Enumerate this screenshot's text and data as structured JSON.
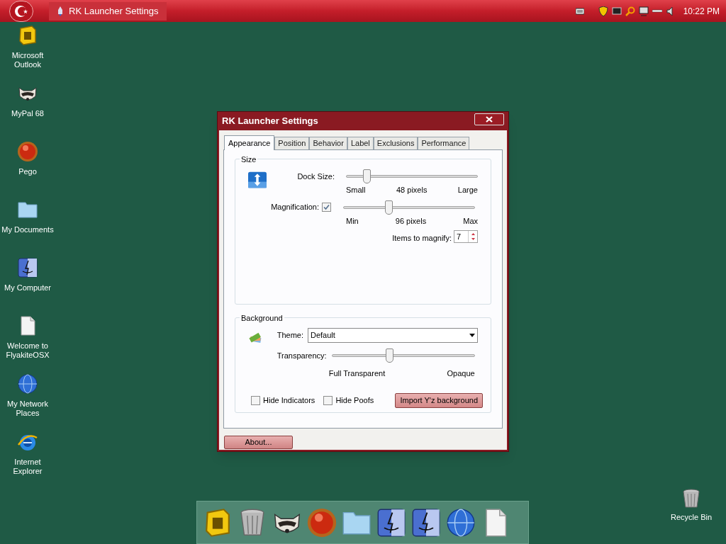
{
  "taskbar": {
    "task": "RK Launcher Settings",
    "clock": "10:22 PM"
  },
  "desktop_icons": [
    {
      "label": "Microsoft Outlook",
      "kind": "tile"
    },
    {
      "label": "MyPal 68",
      "kind": "raccoon"
    },
    {
      "label": "Pego",
      "kind": "ball"
    },
    {
      "label": "My Documents",
      "kind": "folder"
    },
    {
      "label": "My Computer",
      "kind": "finder"
    },
    {
      "label": "Welcome to FlyakiteOSX",
      "kind": "document"
    },
    {
      "label": "My Network Places",
      "kind": "globe"
    },
    {
      "label": "Internet Explorer",
      "kind": "ie"
    }
  ],
  "recycle_bin": {
    "label": "Recycle Bin"
  },
  "dialog": {
    "title": "RK Launcher Settings",
    "tabs": [
      {
        "label": "Appearance",
        "selected": true
      },
      {
        "label": "Position",
        "selected": false
      },
      {
        "label": "Behavior",
        "selected": false
      },
      {
        "label": "Label",
        "selected": false
      },
      {
        "label": "Exclusions",
        "selected": false
      },
      {
        "label": "Performance",
        "selected": false
      }
    ],
    "size_group": {
      "title": "Size",
      "dock_size": {
        "label": "Dock Size:",
        "level": 0.15,
        "min": "Small",
        "reading": "48 pixels",
        "max": "Large"
      },
      "magnification": {
        "label": "Magnification:",
        "checked": true,
        "level": 0.34,
        "min": "Min",
        "reading": "96 pixels",
        "max": "Max"
      },
      "items_to_magnify": {
        "label": "Items to magnify:",
        "value": "7"
      }
    },
    "background_group": {
      "title": "Background",
      "theme": {
        "label": "Theme:",
        "value": "Default"
      },
      "transparency": {
        "label": "Transparency:",
        "level": 0.4,
        "min": "Full Transparent",
        "max": "Opaque"
      },
      "checkboxes": [
        {
          "label": "Hide Indicators",
          "checked": false
        },
        {
          "label": "Hide Poofs",
          "checked": false
        }
      ],
      "import_button": "Import Y'z background"
    },
    "about_button": "About..."
  },
  "dock": [
    {
      "kind": "tile"
    },
    {
      "kind": "bin"
    },
    {
      "kind": "raccoon"
    },
    {
      "kind": "ball"
    },
    {
      "kind": "folder"
    },
    {
      "kind": "finder"
    },
    {
      "kind": "finder"
    },
    {
      "kind": "globe"
    },
    {
      "kind": "document"
    }
  ]
}
